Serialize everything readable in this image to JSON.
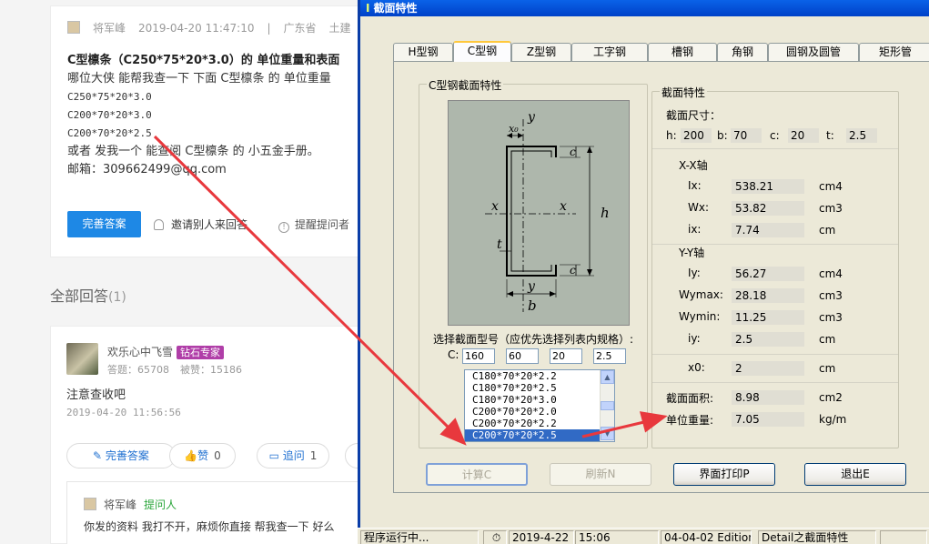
{
  "question": {
    "author": "将军峰",
    "datetime": "2019-04-20 11:47:10",
    "separator": "|",
    "region": "广东省",
    "category": "土建",
    "title": "C型檩条（C250*75*20*3.0）的 单位重量和表面",
    "body_line1": "哪位大侠 能帮我查一下 下面 C型檩条 的 单位重量",
    "spec1": "C250*75*20*3.0",
    "spec2": "C200*70*20*3.0",
    "spec3": "C200*70*20*2.5",
    "body_line2": "或者 发我一个 能查阅  C型檩条 的 小五金手册。",
    "email_line": "邮箱：309662499@qq.com",
    "complete_btn": "完善答案",
    "invite_text": "邀请别人来回答",
    "remind_text": "提醒提问者"
  },
  "answers_header": {
    "label": "全部回答",
    "count": "(1)"
  },
  "answer": {
    "user": "欢乐心中飞雪",
    "badge": "钻石专家",
    "answers_stat": "答题：65708",
    "likes_stat": "被赞：15186",
    "text": "注意查收吧",
    "time": "2019-04-20 11:56:56",
    "btn_complete": "完善答案",
    "btn_like": "赞",
    "like_count": "0",
    "btn_followup": "追问",
    "followup_count": "1",
    "sub_author": "将军峰",
    "sub_role": "提问人",
    "sub_text": "你发的资料 我打不开，麻烦你直接 帮我查一下 好么"
  },
  "dialog": {
    "title": "截面特性",
    "tabs": [
      "H型钢",
      "C型钢",
      "Z型钢",
      "工字钢",
      "槽钢",
      "角钢",
      "圆钢及圆管",
      "矩形管"
    ],
    "active_tab": "C型钢",
    "left_group": "C型钢截面特性",
    "right_group": "截面特性",
    "diagram_labels": {
      "y_top": "y",
      "x0": "x₀",
      "c_top": "c",
      "x_left": "x",
      "x_right": "x",
      "h": "h",
      "t": "t",
      "c_bot": "c",
      "y_bot": "y",
      "b": "b"
    },
    "select_label": "选择截面型号（应优先选择列表内规格）:",
    "c_label": "C:",
    "dims": [
      "160",
      "60",
      "20",
      "2.5"
    ],
    "list_items": [
      "C180*70*20*2.2",
      "C180*70*20*2.5",
      "C180*70*20*3.0",
      "C200*70*20*2.0",
      "C200*70*20*2.2",
      "C200*70*20*2.5"
    ],
    "selected_item": "C200*70*20*2.5",
    "size_title": "截面尺寸：",
    "size": {
      "h_label": "h:",
      "h": "200",
      "b_label": "b:",
      "b": "70",
      "c_label": "c:",
      "c": "20",
      "t_label": "t:",
      "t": "2.5"
    },
    "xx_axis": "X-X轴",
    "yy_axis": "Y-Y轴",
    "props": [
      {
        "label": "Ix:",
        "value": "538.21",
        "unit": "cm4"
      },
      {
        "label": "Wx:",
        "value": "53.82",
        "unit": "cm3"
      },
      {
        "label": "ix:",
        "value": "7.74",
        "unit": "cm"
      },
      {
        "label": "Iy:",
        "value": "56.27",
        "unit": "cm4"
      },
      {
        "label": "Wymax:",
        "value": "28.18",
        "unit": "cm3"
      },
      {
        "label": "Wymin:",
        "value": "11.25",
        "unit": "cm3"
      },
      {
        "label": "iy:",
        "value": "2.5",
        "unit": "cm"
      },
      {
        "label": "x0:",
        "value": "2",
        "unit": "cm"
      },
      {
        "label": "截面面积:",
        "value": "8.98",
        "unit": "cm2"
      },
      {
        "label": "单位重量:",
        "value": "7.05",
        "unit": "kg/m"
      }
    ],
    "buttons": {
      "calc": "计算C",
      "refresh": "刷新N",
      "print": "界面打印P",
      "exit": "退出E"
    }
  },
  "statusbar": {
    "status": "程序运行中...",
    "date": "2019-4-22",
    "time": "15:06",
    "edition": "04-04-02 Edition",
    "module": "Detail之截面特性"
  },
  "colors": {
    "title_blue": "#0a62e8",
    "link_blue": "#1e88e5",
    "arrow_red": "#e8383d",
    "badge_purple": "#b03ea8",
    "selection": "#316ac5"
  }
}
